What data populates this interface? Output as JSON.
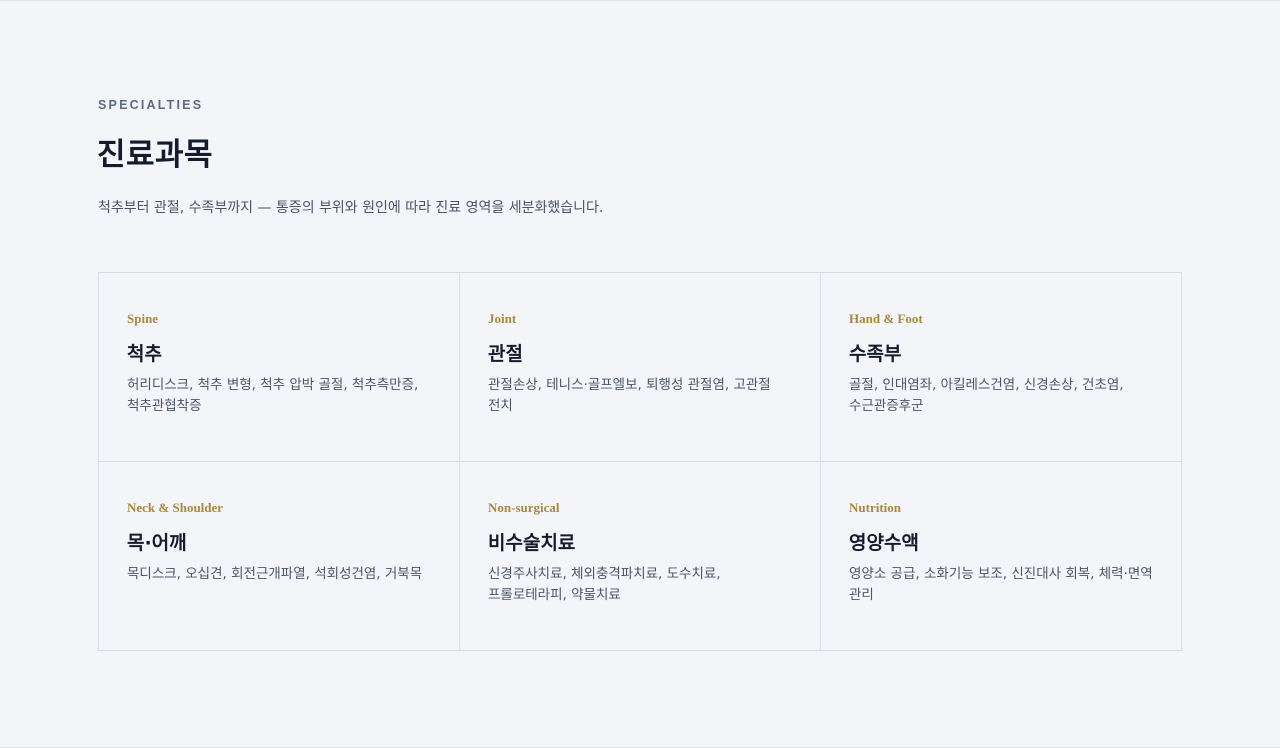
{
  "section": {
    "eyebrow": "SPECIALTIES",
    "title": "진료과목",
    "intro": "척추부터 관절, 수족부까지 — 통증의 부위와 원인에 따라 진료 영역을 세분화했습니다."
  },
  "cards": [
    {
      "eyebrow": "Spine",
      "title": "척추",
      "desc": "허리디스크, 척추 변형, 척추 압박 골절, 척추측만증, 척추관협착증"
    },
    {
      "eyebrow": "Joint",
      "title": "관절",
      "desc": "관절손상, 테니스·골프엘보, 퇴행성 관절염, 고관절 전치"
    },
    {
      "eyebrow": "Hand & Foot",
      "title": "수족부",
      "desc": "골절, 인대염좌, 아킬레스건염, 신경손상, 건초염, 수근관증후군"
    },
    {
      "eyebrow": "Neck & Shoulder",
      "title": "목·어깨",
      "desc": "목디스크, 오십견, 회전근개파열, 석회성건염, 거북목"
    },
    {
      "eyebrow": "Non-surgical",
      "title": "비수술치료",
      "desc": "신경주사치료, 체외충격파치료, 도수치료, 프롤로테라피, 약물치료"
    },
    {
      "eyebrow": "Nutrition",
      "title": "영양수액",
      "desc": "영양소 공급, 소화기능 보조, 신진대사 회복, 체력·면역 관리"
    }
  ],
  "colors": {
    "background": "#f4f5f9",
    "accent": "#a8893e",
    "heading": "#141b2d",
    "body_text": "#4a5568",
    "eyebrow": "#5b6b85",
    "border": "#d8dce5"
  }
}
